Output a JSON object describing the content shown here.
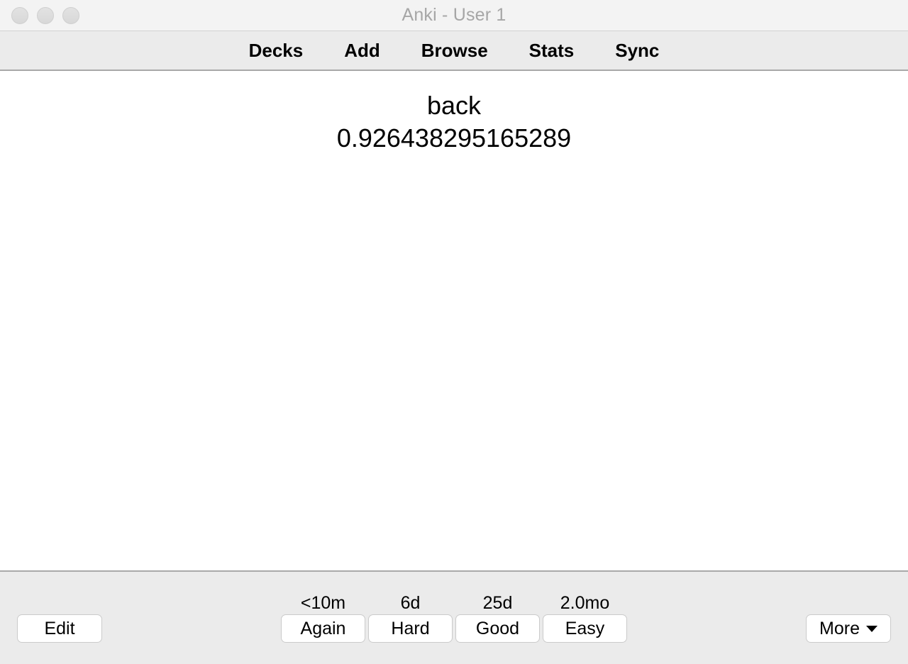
{
  "window": {
    "title": "Anki - User 1",
    "traffic_lights": [
      "close",
      "minimize",
      "zoom"
    ]
  },
  "menubar": {
    "items": [
      {
        "label": "Decks",
        "name": "decks"
      },
      {
        "label": "Add",
        "name": "add"
      },
      {
        "label": "Browse",
        "name": "browse"
      },
      {
        "label": "Stats",
        "name": "stats"
      },
      {
        "label": "Sync",
        "name": "sync"
      }
    ]
  },
  "card": {
    "side": "back",
    "lines": [
      "back",
      "0.926438295165289"
    ]
  },
  "bottombar": {
    "edit_label": "Edit",
    "more_label": "More",
    "more_icon": "chevron-down-icon",
    "answers": [
      {
        "interval": "<10m",
        "label": "Again"
      },
      {
        "interval": "6d",
        "label": "Hard"
      },
      {
        "interval": "25d",
        "label": "Good"
      },
      {
        "interval": "2.0mo",
        "label": "Easy"
      }
    ]
  },
  "colors": {
    "titlebar_bg": "#f3f3f3",
    "menubar_bg": "#ebebeb",
    "bottombar_bg": "#ebebeb",
    "card_bg": "#ffffff",
    "title_text": "#a6a6a6",
    "border": "#a9a9a9",
    "button_bg": "#ffffff",
    "button_border": "#cbcbcb"
  }
}
